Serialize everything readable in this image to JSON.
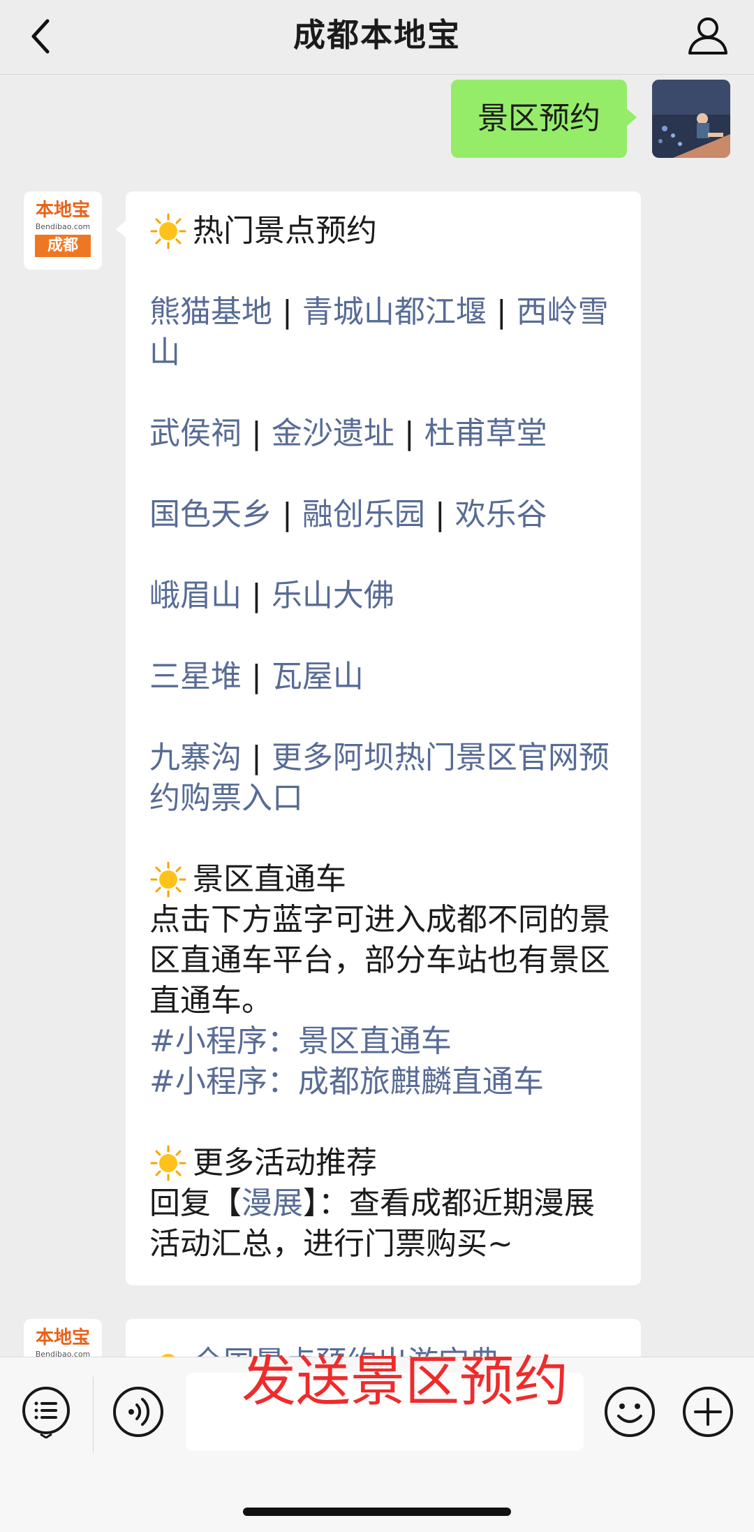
{
  "header": {
    "title": "成都本地宝"
  },
  "outgoing": {
    "text": "景区预约"
  },
  "bot_avatar": {
    "brand_top": "本地宝",
    "brand_url": "Bendibao.com",
    "brand_city": "成都"
  },
  "message": {
    "section1_title": "热门景点预约",
    "line1": {
      "a": "熊猫基地",
      "b": "青城山都江堰",
      "c": "西岭雪山"
    },
    "line2": {
      "a": "武侯祠",
      "b": "金沙遗址",
      "c": "杜甫草堂"
    },
    "line3": {
      "a": "国色天乡",
      "b": "融创乐园",
      "c": "欢乐谷"
    },
    "line4": {
      "a": "峨眉山",
      "b": "乐山大佛"
    },
    "line5": {
      "a": "三星堆",
      "b": "瓦屋山"
    },
    "line6": {
      "a": "九寨沟",
      "b": "更多阿坝热门景区官网预约购票入口"
    },
    "separator": "|",
    "section2_title": "景区直通车",
    "section2_desc": "点击下方蓝字可进入成都不同的景区直通车平台，部分车站也有景区直通车。",
    "mini1": "#小程序：景区直通车",
    "mini2": "#小程序：成都旅麒麟直通车",
    "section3_title": "更多活动推荐",
    "reply_prefix": "回复【",
    "reply_keyword": "漫展",
    "reply_suffix": "】：查看成都近期漫展活动汇总，进行门票购买~"
  },
  "message2": {
    "text": "全国景点预约出游宝典"
  },
  "overlay": {
    "text": "发送景区预约"
  },
  "colors": {
    "link": "#576b95",
    "bubble_out": "#95ec69",
    "overlay": "#ef2b2b",
    "brand": "#f07722"
  }
}
